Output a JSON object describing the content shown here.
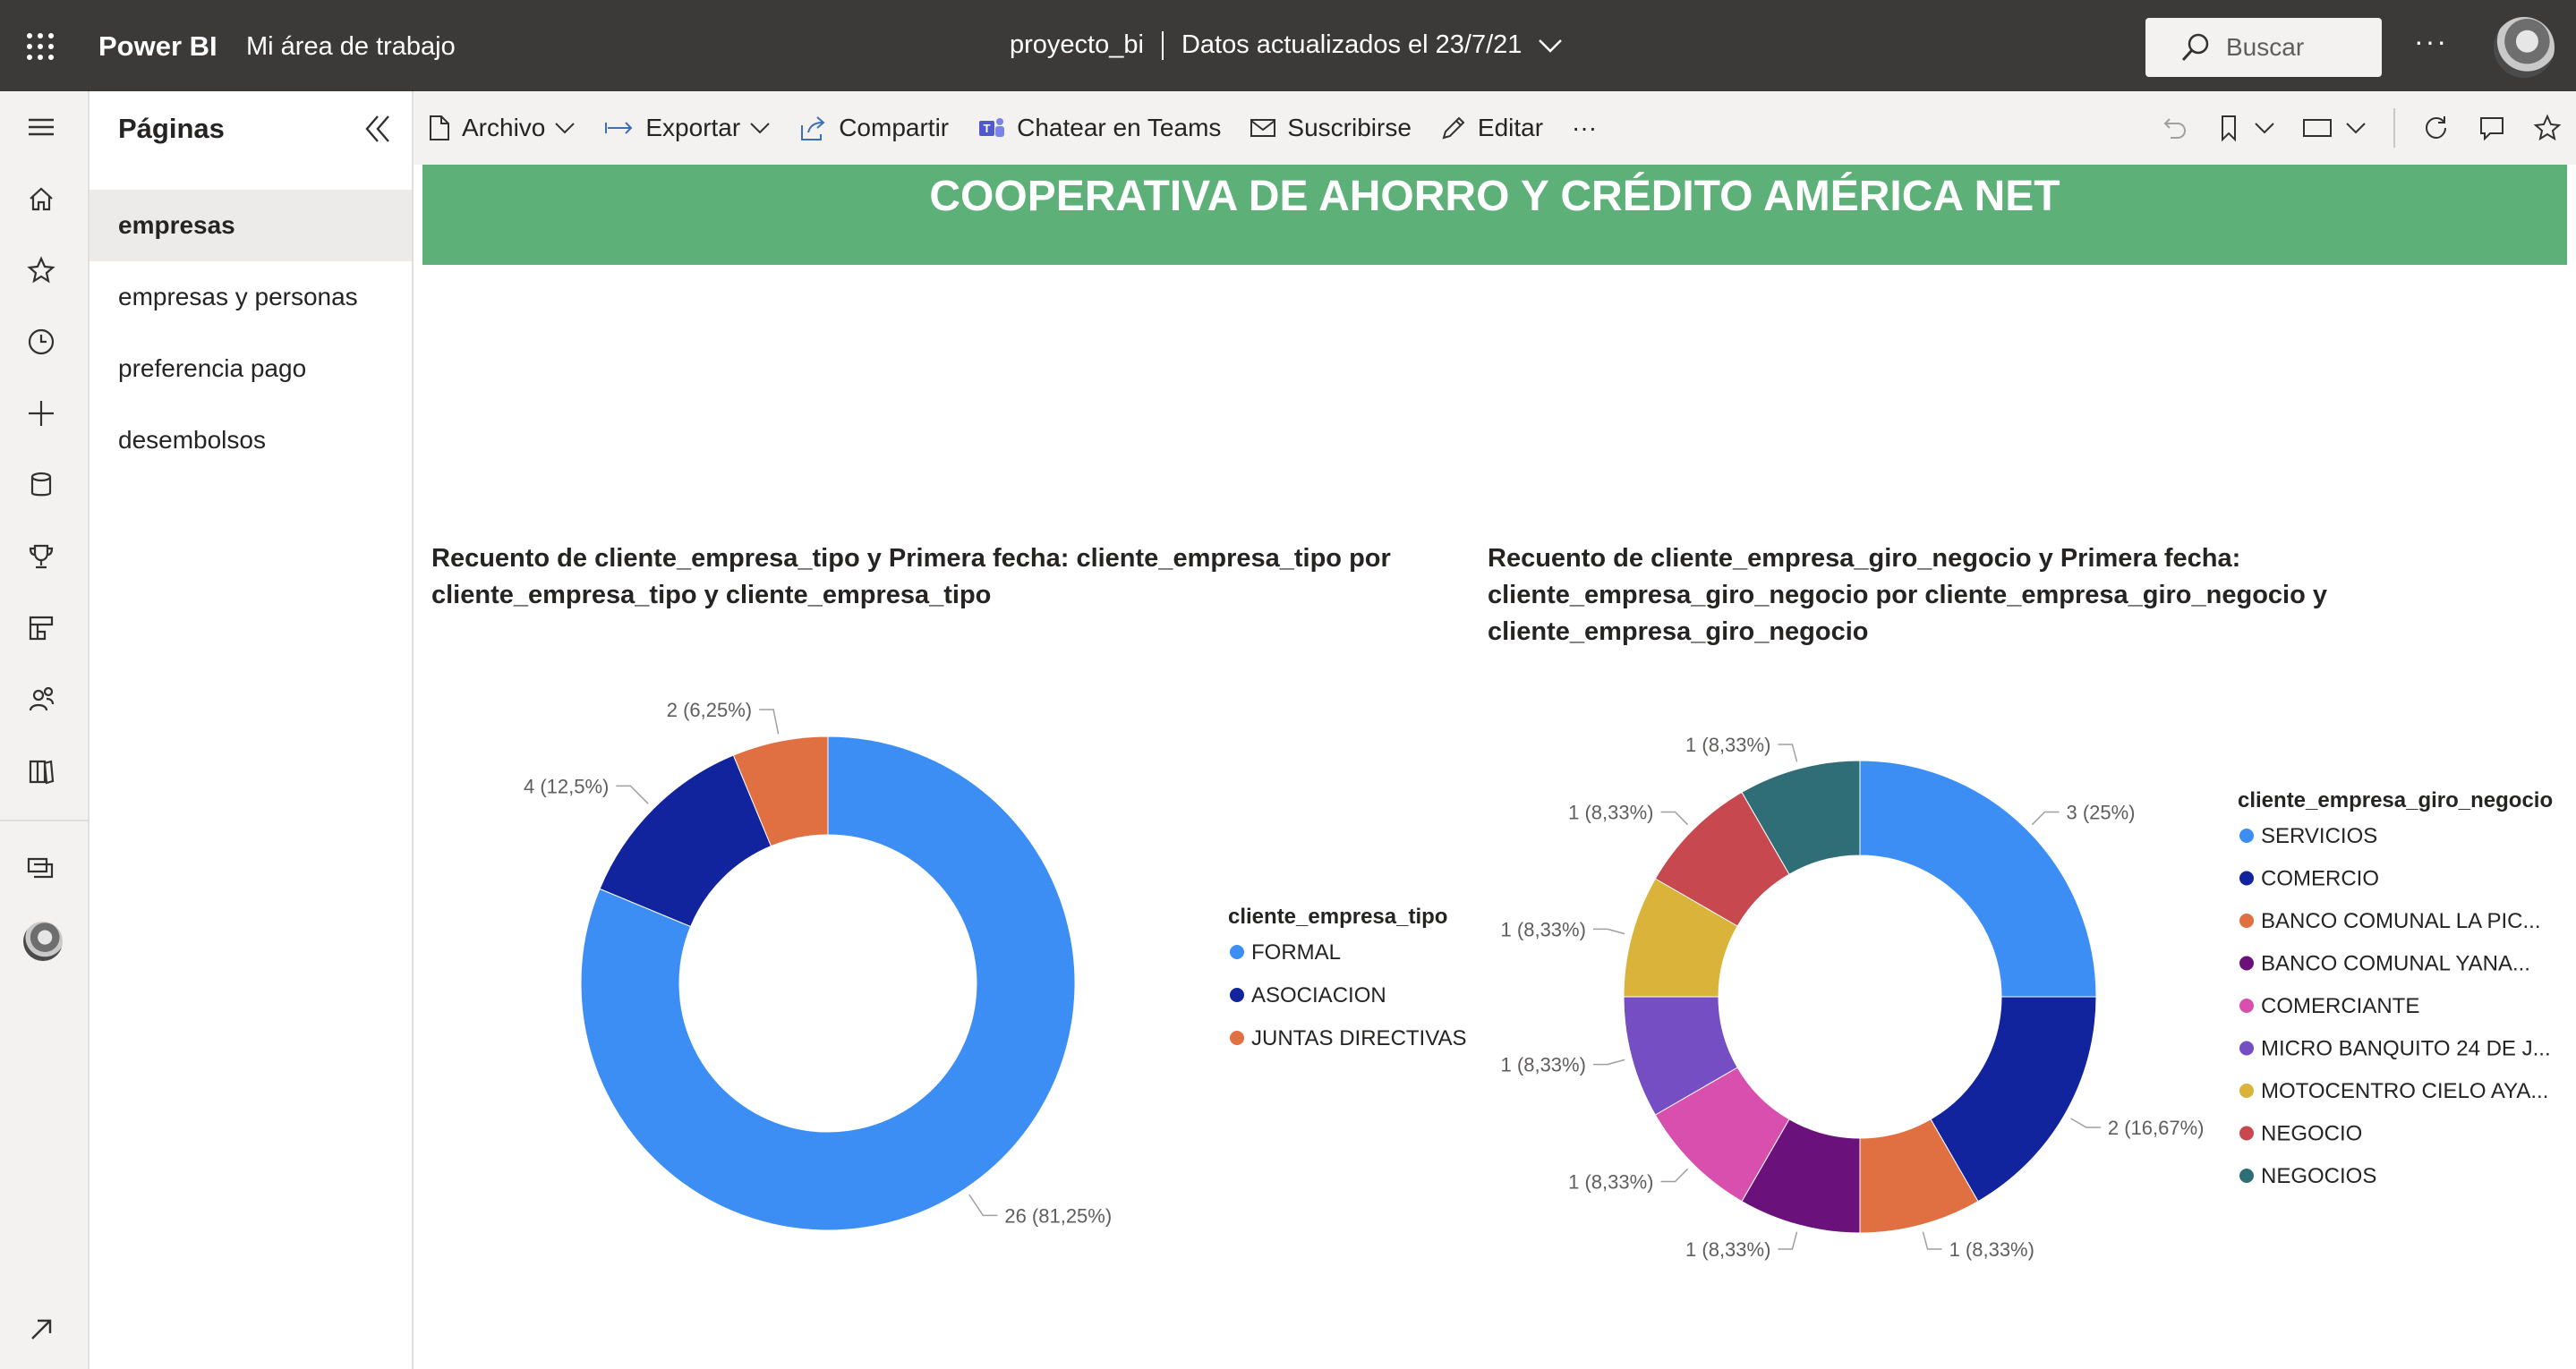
{
  "topbar": {
    "brand": "Power BI",
    "workspace": "Mi área de trabajo",
    "report_name": "proyecto_bi",
    "updated": "Datos actualizados el 23/7/21",
    "search_placeholder": "Buscar",
    "more": "···"
  },
  "pages_panel": {
    "title": "Páginas",
    "items": [
      {
        "label": "empresas",
        "active": true
      },
      {
        "label": "empresas y personas",
        "active": false
      },
      {
        "label": "preferencia pago",
        "active": false
      },
      {
        "label": "desembolsos",
        "active": false
      }
    ]
  },
  "toolbar": {
    "archivo": "Archivo",
    "exportar": "Exportar",
    "compartir": "Compartir",
    "teams": "Chatear en Teams",
    "suscribirse": "Suscribirse",
    "editar": "Editar",
    "more": "···"
  },
  "report": {
    "banner": "COOPERATIVA DE AHORRO Y CRÉDITO AMÉRICA NET"
  },
  "chart_data": [
    {
      "type": "pie",
      "donut": true,
      "title": "Recuento de cliente_empresa_tipo y Primera fecha: cliente_empresa_tipo por cliente_empresa_tipo y cliente_empresa_tipo",
      "legend_title": "cliente_empresa_tipo",
      "legend_position": "right",
      "categories": [
        "FORMAL",
        "ASOCIACION",
        "JUNTAS DIRECTIVAS"
      ],
      "values": [
        26,
        4,
        2
      ],
      "labels": [
        "26 (81,25%)",
        "4 (12,5%)",
        "2 (6,25%)"
      ],
      "colors": [
        "#3c8ef5",
        "#12239e",
        "#e07042"
      ]
    },
    {
      "type": "pie",
      "donut": true,
      "title": "Recuento de cliente_empresa_giro_negocio y Primera fecha: cliente_empresa_giro_negocio por cliente_empresa_giro_negocio y cliente_empresa_giro_negocio",
      "legend_title": "cliente_empresa_giro_negocio",
      "legend_position": "right",
      "categories": [
        "SERVICIOS",
        "COMERCIO",
        "BANCO COMUNAL LA PIC...",
        "BANCO COMUNAL YANA...",
        "COMERCIANTE",
        "MICRO BANQUITO 24 DE J...",
        "MOTOCENTRO CIELO AYA...",
        "NEGOCIO",
        "NEGOCIOS"
      ],
      "values": [
        3,
        2,
        1,
        1,
        1,
        1,
        1,
        1,
        1
      ],
      "labels": [
        "3 (25%)",
        "2 (16,67%)",
        "1 (8,33%)",
        "1 (8,33%)",
        "1 (8,33%)",
        "1 (8,33%)",
        "1 (8,33%)",
        "1 (8,33%)",
        "1 (8,33%)"
      ],
      "colors": [
        "#3c8ef5",
        "#12239e",
        "#e07042",
        "#6b117c",
        "#d84fae",
        "#744ec2",
        "#d9b33a",
        "#c8484f",
        "#2f6e77"
      ]
    }
  ]
}
